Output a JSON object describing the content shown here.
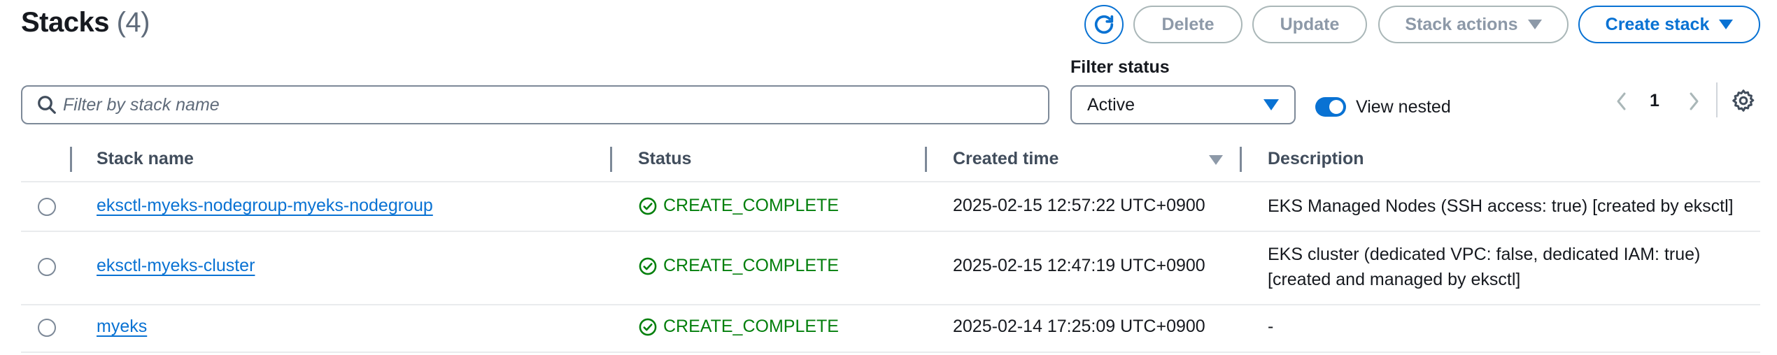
{
  "header": {
    "title": "Stacks",
    "count": "(4)",
    "buttons": {
      "delete": "Delete",
      "update": "Update",
      "stack_actions": "Stack actions",
      "create_stack": "Create stack"
    }
  },
  "filters": {
    "search_placeholder": "Filter by stack name",
    "status_label": "Filter status",
    "status_value": "Active",
    "view_nested_label": "View nested",
    "view_nested_on": true
  },
  "pagination": {
    "current_page": "1"
  },
  "table": {
    "columns": [
      "Stack name",
      "Status",
      "Created time",
      "Description"
    ],
    "sorted_column": "Created time",
    "rows": [
      {
        "name": "eksctl-myeks-nodegroup-myeks-nodegroup",
        "status": "CREATE_COMPLETE",
        "created": "2025-02-15 12:57:22 UTC+0900",
        "description": "EKS Managed Nodes (SSH access: true) [created by eksctl]"
      },
      {
        "name": "eksctl-myeks-cluster",
        "status": "CREATE_COMPLETE",
        "created": "2025-02-15 12:47:19 UTC+0900",
        "description": "EKS cluster (dedicated VPC: false, dedicated IAM: true) [created and managed by eksctl]"
      },
      {
        "name": "myeks",
        "status": "CREATE_COMPLETE",
        "created": "2025-02-14 17:25:09 UTC+0900",
        "description": "-"
      }
    ]
  },
  "colors": {
    "primary": "#0972d3",
    "success": "#037f0c",
    "disabled": "#8d99a8"
  },
  "icons": {
    "refresh": "refresh-icon",
    "search": "search-icon",
    "status_ok": "check-circle-icon",
    "settings": "gear-icon"
  }
}
